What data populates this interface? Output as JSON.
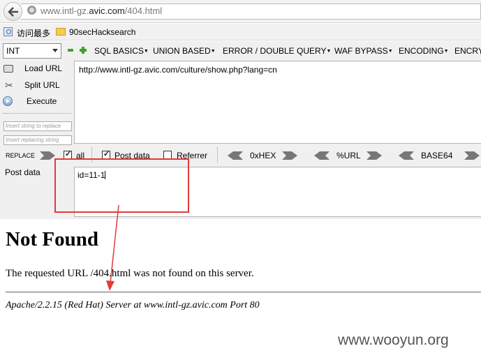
{
  "browser": {
    "url_prefix": "www.intl-gz.",
    "url_domain": "avic.com",
    "url_path": "/404.html"
  },
  "bookmarks": [
    {
      "label": "访问最多",
      "icon": "bookmark-page-icon"
    },
    {
      "label": "90secHacksearch",
      "icon": "folder-icon"
    }
  ],
  "hackbar": {
    "type_select": "INT",
    "menus": [
      "SQL BASICS",
      "UNION BASED",
      "ERROR / DOUBLE QUERY",
      "WAF BYPASS",
      "ENCODING",
      "ENCRYPTION"
    ],
    "actions": {
      "load": "Load URL",
      "split": "Split URL",
      "execute": "Execute"
    },
    "find_placeholder": "Insert string to replace",
    "replace_placeholder": "Insert replacing string",
    "url_value": "http://www.intl-gz.avic.com/culture/show.php?lang=cn",
    "replace_label": "REPLACE",
    "options": {
      "all": {
        "label": "all",
        "checked": true
      },
      "post": {
        "label": "Post data",
        "checked": true
      },
      "referrer": {
        "label": "Referrer",
        "checked": false
      }
    },
    "encoders": [
      "0xHEX",
      "%URL",
      "BASE64"
    ],
    "post_label": "Post data",
    "post_value": "id=11-1"
  },
  "page": {
    "title": "Not Found",
    "message": "The requested URL /404.html was not found on this server.",
    "address": "Apache/2.2.15 (Red Hat) Server at www.intl-gz.avic.com Port 80"
  },
  "watermark": "www.wooyun.org",
  "colors": {
    "highlight": "#e23a3a",
    "accent_green": "#3da326"
  }
}
